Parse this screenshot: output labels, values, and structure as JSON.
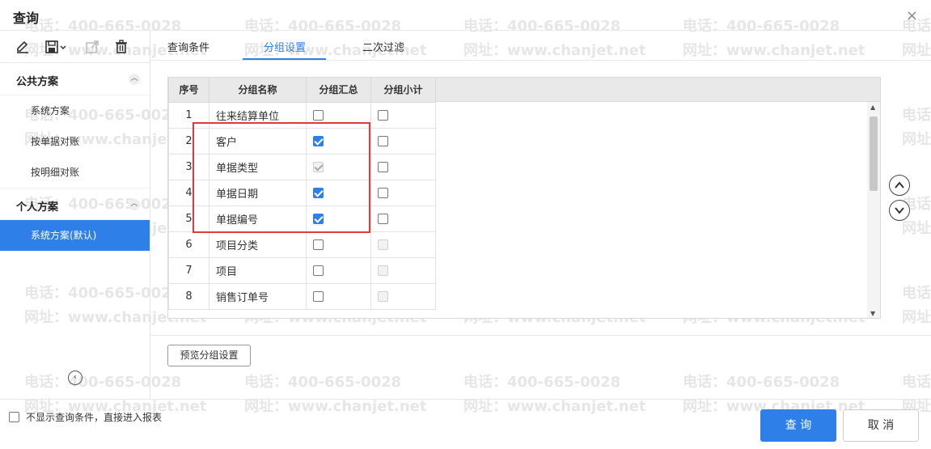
{
  "dialog": {
    "title": "查询",
    "close_glyph": "×"
  },
  "toolbar": {
    "icons": [
      "edit-icon",
      "save-icon",
      "export-icon",
      "delete-icon"
    ]
  },
  "sidebar": {
    "public_group": {
      "title": "公共方案",
      "items": [
        "系统方案",
        "按单据对账",
        "按明细对账"
      ]
    },
    "personal_group": {
      "title": "个人方案",
      "items": [
        "系统方案(默认)"
      ]
    },
    "collapse_glyph": "‹"
  },
  "tabs": [
    {
      "label": "查询条件",
      "active": false
    },
    {
      "label": "分组设置",
      "active": true
    },
    {
      "label": "二次过滤",
      "active": false
    }
  ],
  "grid": {
    "headers": [
      "序号",
      "分组名称",
      "分组汇总",
      "分组小计"
    ],
    "rows": [
      {
        "no": "1",
        "name": "往来结算单位",
        "summary": false,
        "summary_disabled": false,
        "subtotal": false,
        "subtotal_disabled": false
      },
      {
        "no": "2",
        "name": "客户",
        "summary": true,
        "summary_disabled": false,
        "subtotal": false,
        "subtotal_disabled": false
      },
      {
        "no": "3",
        "name": "单据类型",
        "summary": true,
        "summary_disabled": true,
        "subtotal": false,
        "subtotal_disabled": false
      },
      {
        "no": "4",
        "name": "单据日期",
        "summary": true,
        "summary_disabled": false,
        "subtotal": false,
        "subtotal_disabled": false
      },
      {
        "no": "5",
        "name": "单据编号",
        "summary": true,
        "summary_disabled": false,
        "subtotal": false,
        "subtotal_disabled": false
      },
      {
        "no": "6",
        "name": "项目分类",
        "summary": false,
        "summary_disabled": false,
        "subtotal": false,
        "subtotal_disabled": true
      },
      {
        "no": "7",
        "name": "项目",
        "summary": false,
        "summary_disabled": false,
        "subtotal": false,
        "subtotal_disabled": true
      },
      {
        "no": "8",
        "name": "销售订单号",
        "summary": false,
        "summary_disabled": false,
        "subtotal": false,
        "subtotal_disabled": true
      }
    ]
  },
  "preview_button": "预览分组设置",
  "footer": {
    "skip_label": "不显示查询条件，直接进入报表",
    "skip_checked": false,
    "query_button": "查 询",
    "cancel_button": "取 消"
  },
  "watermark": {
    "phone": "电话：400-665-0028",
    "site": "网址：www.chanjet.net"
  },
  "colors": {
    "accent": "#2e80e8",
    "highlight_box": "#e0393e"
  }
}
